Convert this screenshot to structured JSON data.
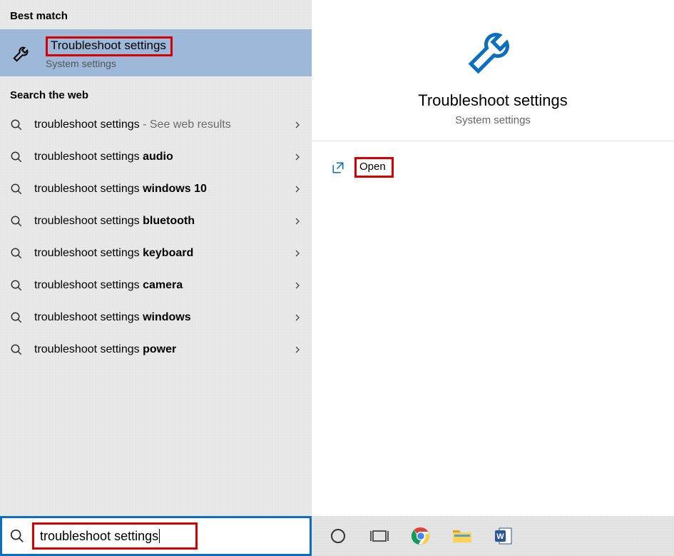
{
  "left": {
    "best_match_header": "Best match",
    "best_match": {
      "title": "Troubleshoot settings",
      "subtitle": "System settings"
    },
    "web_header": "Search the web",
    "web_results": [
      {
        "prefix": "troubleshoot settings",
        "suffix": "",
        "trailer": " - See web results"
      },
      {
        "prefix": "troubleshoot settings ",
        "suffix": "audio",
        "trailer": ""
      },
      {
        "prefix": "troubleshoot settings ",
        "suffix": "windows 10",
        "trailer": ""
      },
      {
        "prefix": "troubleshoot settings ",
        "suffix": "bluetooth",
        "trailer": ""
      },
      {
        "prefix": "troubleshoot settings ",
        "suffix": "keyboard",
        "trailer": ""
      },
      {
        "prefix": "troubleshoot settings ",
        "suffix": "camera",
        "trailer": ""
      },
      {
        "prefix": "troubleshoot settings ",
        "suffix": "windows",
        "trailer": ""
      },
      {
        "prefix": "troubleshoot settings ",
        "suffix": "power",
        "trailer": ""
      }
    ]
  },
  "right": {
    "title": "Troubleshoot settings",
    "subtitle": "System settings",
    "open_label": "Open"
  },
  "searchbar": {
    "value": "troubleshoot settings"
  },
  "icons": {
    "wrench": "wrench-icon",
    "search": "search-icon",
    "chevron": "chevron-right-icon",
    "open": "open-icon",
    "cortana": "cortana-icon",
    "taskview": "task-view-icon",
    "chrome": "chrome-icon",
    "explorer": "file-explorer-icon",
    "word": "word-icon"
  }
}
